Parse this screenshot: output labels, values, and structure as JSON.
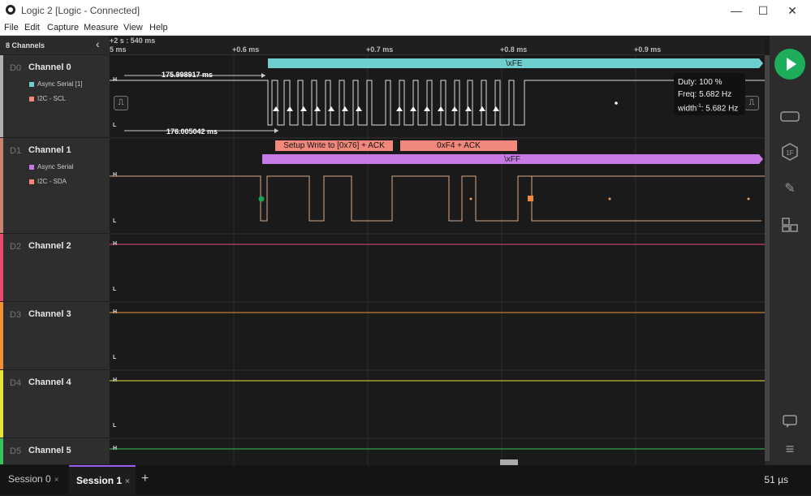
{
  "window": {
    "title": "Logic 2 [Logic - Connected]",
    "minimize": "—",
    "maximize": "☐",
    "close": "✕"
  },
  "menu": [
    "File",
    "Edit",
    "Capture",
    "Measure",
    "View",
    "Help"
  ],
  "sidebar": {
    "header": "8 Channels",
    "collapse_icon": "‹",
    "channels": [
      {
        "id": "D0",
        "name": "Channel 0",
        "color": "#b0b0b0",
        "analyzers": [
          {
            "label": "Async Serial [1]",
            "color": "#6fcfcf"
          },
          {
            "label": "I2C - SCL",
            "color": "#f2877c"
          }
        ]
      },
      {
        "id": "D1",
        "name": "Channel 1",
        "color": "#c8846d",
        "analyzers": [
          {
            "label": "Async Serial",
            "color": "#c77ae6"
          },
          {
            "label": "I2C - SDA",
            "color": "#f2877c"
          }
        ]
      },
      {
        "id": "D2",
        "name": "Channel 2",
        "color": "#e84a6e",
        "analyzers": []
      },
      {
        "id": "D3",
        "name": "Channel 3",
        "color": "#f0923a",
        "analyzers": []
      },
      {
        "id": "D4",
        "name": "Channel 4",
        "color": "#e8e23a",
        "analyzers": []
      },
      {
        "id": "D5",
        "name": "Channel 5",
        "color": "#38c25a",
        "analyzers": []
      }
    ]
  },
  "ruler": {
    "offset_label": "+2 s : 540 ms",
    "start_label": "5 ms",
    "ticks": [
      "+0.6 ms",
      "+0.7 ms",
      "+0.8 ms",
      "+0.9 ms"
    ]
  },
  "waveform": {
    "high_label": "H",
    "low_label": "L",
    "ch0_frame_label": "\\xFE",
    "ch1_frame_label": "\\xFF",
    "i2c_frames": [
      "Setup Write to [0x76] + ACK",
      "0xF4 + ACK"
    ],
    "measure_high": "175.998917 ms",
    "measure_low": "176.005042 ms",
    "pulse_icon_left": "⎍",
    "pulse_icon_right": "⎍",
    "tooltip": {
      "duty": "Duty: 100 %",
      "freq": "Freq: 5.682 Hz",
      "width_prefix": "width",
      "width_sup": "-1",
      "width_value": ": 5.682 Hz"
    }
  },
  "rightbar": {
    "icons": [
      "play-icon",
      "analyzers-icon",
      "hex-icon",
      "measure-icon",
      "extensions-icon",
      "comment-icon",
      "menu-icon"
    ],
    "hex_glyph": "1F",
    "measure_glyph": "✎",
    "comment_glyph": "💬",
    "menu_glyph": "≡"
  },
  "tabs": {
    "items": [
      {
        "label": "Session 0",
        "close": "×"
      },
      {
        "label": "Session 1",
        "close": "×"
      }
    ],
    "add": "+",
    "zoom": "51 µs"
  }
}
